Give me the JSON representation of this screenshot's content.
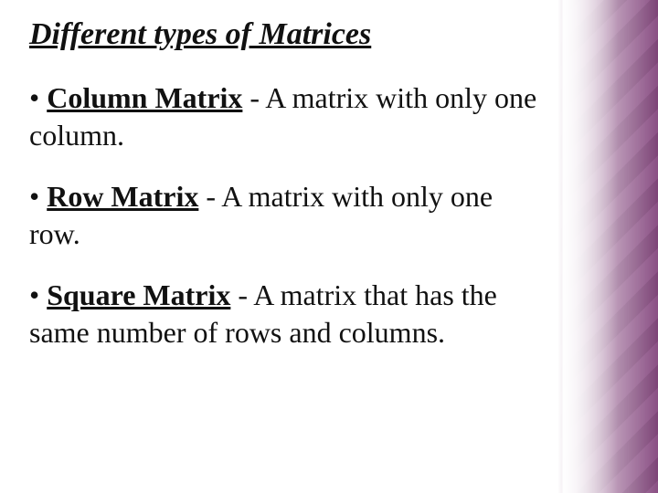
{
  "title": "Different types of Matrices",
  "bullets": [
    {
      "marker": "• ",
      "term": "Column Matrix",
      "desc": " - A matrix with only one column."
    },
    {
      "marker": "• ",
      "term": "Row Matrix",
      "desc": " - A matrix with only one row."
    },
    {
      "marker": "• ",
      "term": "Square Matrix",
      "desc": " - A matrix that has the same number of rows and columns."
    }
  ]
}
